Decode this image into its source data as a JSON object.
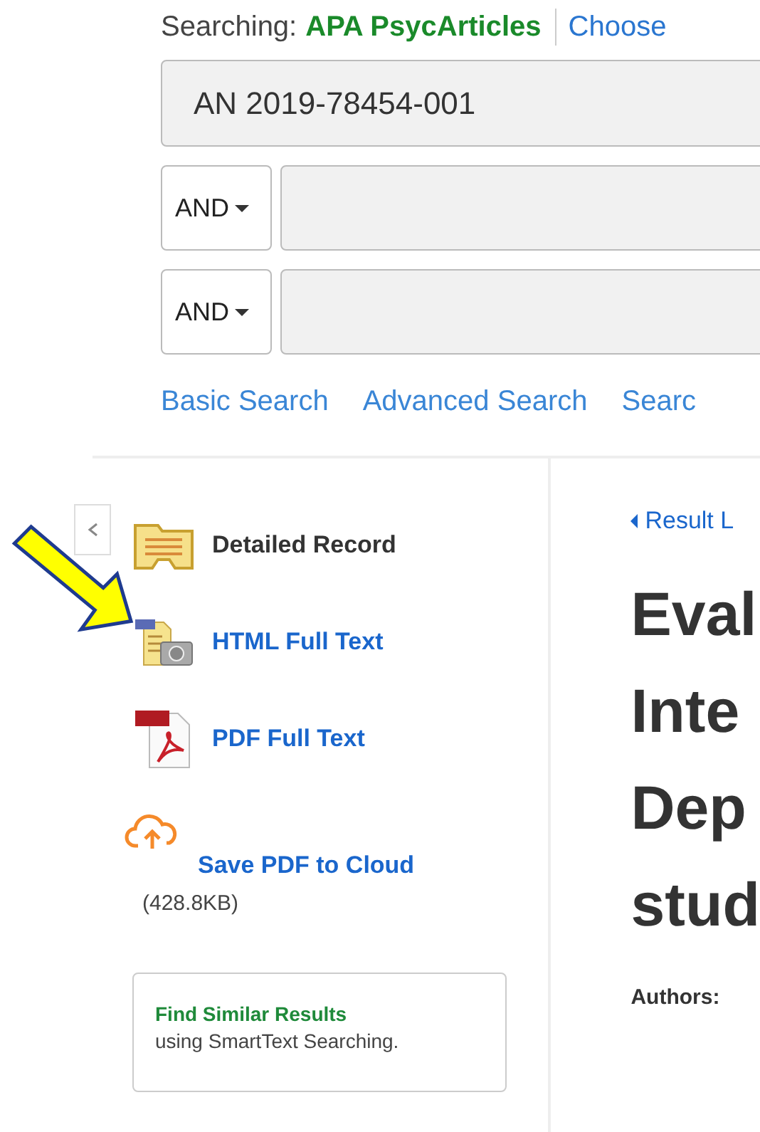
{
  "search": {
    "label": "Searching:",
    "database": "APA PsycArticles",
    "choose_link": "Choose",
    "query": "AN 2019-78454-001",
    "rows": [
      {
        "operator": "AND",
        "value": ""
      },
      {
        "operator": "AND",
        "value": ""
      }
    ],
    "links": [
      "Basic Search",
      "Advanced Search",
      "Searc"
    ]
  },
  "sidebar": {
    "items": [
      {
        "kind": "record",
        "label": "Detailed Record"
      },
      {
        "kind": "html",
        "label": "HTML Full Text"
      },
      {
        "kind": "pdf",
        "label": "PDF Full Text"
      },
      {
        "kind": "cloud",
        "label": "Save PDF to Cloud",
        "note": "(428.8KB)"
      }
    ],
    "similar": {
      "title": "Find Similar Results",
      "subtitle": "using SmartText Searching."
    }
  },
  "article": {
    "back_link": "Result L",
    "title_lines": [
      "Eval",
      "Inte",
      "Dep",
      "stud"
    ],
    "authors_label": "Authors:"
  }
}
